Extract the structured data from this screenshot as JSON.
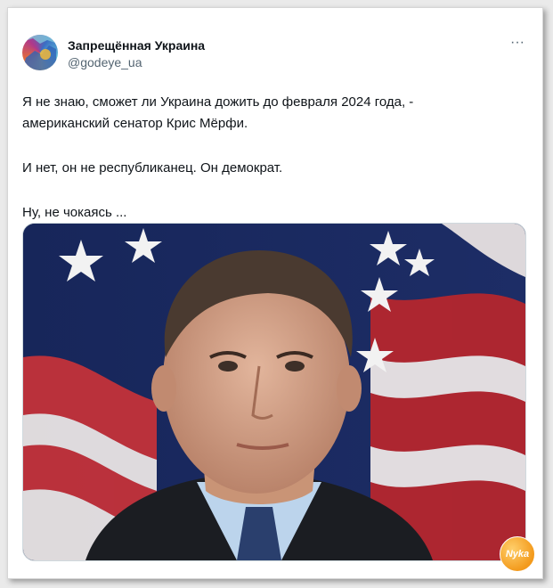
{
  "author": {
    "name": "Запрещённая Украина",
    "handle": "@godeye_ua"
  },
  "menu": {
    "more_label": "···"
  },
  "tweet": {
    "lines": [
      "Я не знаю, сможет ли Украина дожить до февраля 2024 года, -",
      "американский сенатор Крис Мёрфи.",
      "И нет, он не республиканец. Он демократ.",
      "Ну, не чокаясь ..."
    ]
  },
  "media": {
    "description_icon": "photo-portrait-flag"
  },
  "watermark": {
    "text": "Nyka"
  },
  "colors": {
    "text": "#0f1419",
    "secondary": "#536471",
    "flag_blue": "#1c2a5e",
    "flag_red": "#b5262e",
    "watermark": "#f39a1c"
  }
}
